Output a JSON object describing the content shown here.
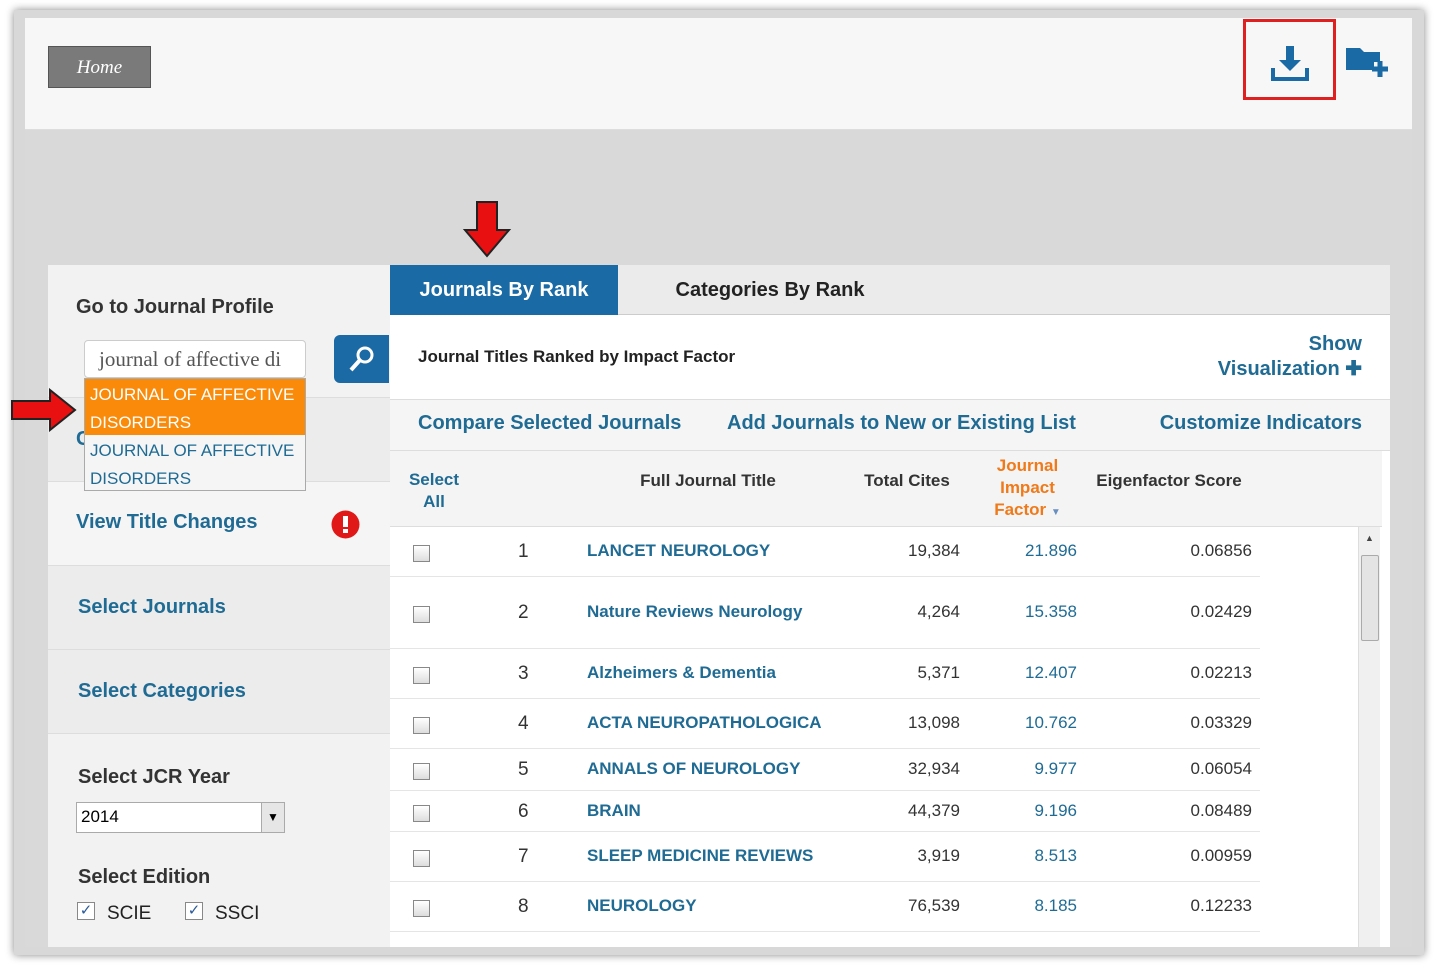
{
  "header": {
    "home_label": "Home",
    "download_icon": "download-icon",
    "add_folder_icon": "folder-plus-icon",
    "highlight_color": "#e02020"
  },
  "sidebar": {
    "journal_profile_title": "Go to Journal Profile",
    "search_value": "journal of affective di",
    "suggestions": [
      "JOURNAL OF AFFECTIVE DISORDERS",
      "JOURNAL OF AFFECTIVE DISORDERS"
    ],
    "hidden_letter": "C",
    "view_title_changes": "View Title Changes",
    "select_journals": "Select Journals",
    "select_categories": "Select Categories",
    "jcr_year_title": "Select JCR Year",
    "jcr_year_value": "2014",
    "edition_title": "Select Edition",
    "editions": [
      {
        "label": "SCIE",
        "checked": true
      },
      {
        "label": "SSCI",
        "checked": true
      }
    ]
  },
  "main": {
    "tabs": [
      {
        "label": "Journals By Rank",
        "active": true
      },
      {
        "label": "Categories By Rank",
        "active": false
      }
    ],
    "subtitle": "Journal Titles Ranked by Impact Factor",
    "show_viz_line1": "Show",
    "show_viz_line2": "Visualization",
    "actions": [
      "Compare Selected Journals",
      "Add Journals to New or Existing List",
      "Customize Indicators"
    ],
    "columns": {
      "select_all_1": "Select",
      "select_all_2": "All",
      "title": "Full Journal Title",
      "cites": "Total Cites",
      "jif_1": "Journal",
      "jif_2": "Impact",
      "jif_3": "Factor",
      "eigen": "Eigenfactor Score"
    },
    "rows": [
      {
        "rank": "1",
        "title": "LANCET NEUROLOGY",
        "cites": "19,384",
        "jif": "21.896",
        "eigen": "0.06856"
      },
      {
        "rank": "2",
        "title": "Nature Reviews Neurology",
        "cites": "4,264",
        "jif": "15.358",
        "eigen": "0.02429"
      },
      {
        "rank": "3",
        "title": "Alzheimers & Dementia",
        "cites": "5,371",
        "jif": "12.407",
        "eigen": "0.02213"
      },
      {
        "rank": "4",
        "title": "ACTA NEUROPATHOLOGICA",
        "cites": "13,098",
        "jif": "10.762",
        "eigen": "0.03329"
      },
      {
        "rank": "5",
        "title": "ANNALS OF NEUROLOGY",
        "cites": "32,934",
        "jif": "9.977",
        "eigen": "0.06054"
      },
      {
        "rank": "6",
        "title": "BRAIN",
        "cites": "44,379",
        "jif": "9.196",
        "eigen": "0.08489"
      },
      {
        "rank": "7",
        "title": "SLEEP MEDICINE REVIEWS",
        "cites": "3,919",
        "jif": "8.513",
        "eigen": "0.00959"
      },
      {
        "rank": "8",
        "title": "NEUROLOGY",
        "cites": "76,539",
        "jif": "8.185",
        "eigen": "0.12233"
      }
    ]
  }
}
